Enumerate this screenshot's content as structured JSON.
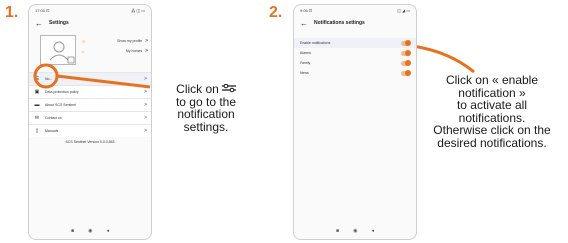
{
  "colors": {
    "accent": "#e8711f"
  },
  "step1": {
    "number": "1.",
    "status_time": "17:00 ⊡",
    "status_right": "⁂ ◫ ▭",
    "header": {
      "title": "Settings",
      "back_icon": "back-arrow-icon"
    },
    "profile_menu": {
      "show_profile": "Show my profile",
      "my_homes": "My homes"
    },
    "rows": [
      {
        "label": "No...",
        "icon": "settings-sliders-icon"
      },
      {
        "label": "Data protection policy",
        "icon": "shield-icon"
      },
      {
        "label": "About SCS Sentinel",
        "icon": "logo-icon"
      },
      {
        "label": "Contact us",
        "icon": "mail-icon"
      },
      {
        "label": "Manuals",
        "icon": "document-icon"
      }
    ],
    "version": "SCS Sentinel Version 0.0.0.863"
  },
  "caption1": {
    "line1_prefix": "Click on",
    "line2": "to go to the",
    "line3": "notification",
    "line4": "settings."
  },
  "step2": {
    "number": "2.",
    "status_time": "9:05 ⊡",
    "status_right": "◫ ◢ ▭",
    "header": {
      "title": "Notifications settings",
      "back_icon": "back-arrow-icon"
    },
    "rows": [
      {
        "label": "Enable notifications",
        "state": "on"
      },
      {
        "label": "Alarms",
        "state": "on"
      },
      {
        "label": "Family",
        "state": "on"
      },
      {
        "label": "News",
        "state": "on"
      }
    ]
  },
  "caption2": {
    "lines": [
      "Click on « enable",
      "notification »",
      "to activate all",
      "notifications.",
      "Otherwise click on the",
      "desired notifications."
    ]
  }
}
